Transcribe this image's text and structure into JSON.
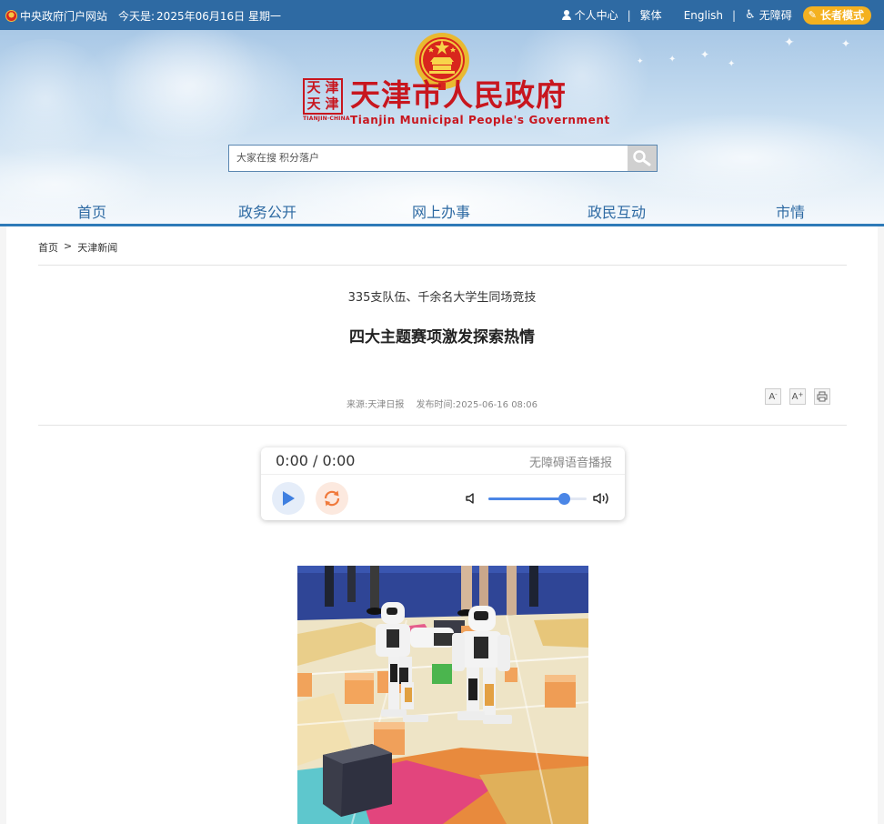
{
  "topbar": {
    "gov_portal": "中央政府门户网站",
    "date_prefix": "今天是:",
    "date": "2025年06月16日 星期一",
    "personal_center": "个人中心",
    "traditional": "繁体",
    "english": "English",
    "accessibility": "无障碍",
    "elder_mode": "长者模式",
    "separator": "|"
  },
  "header": {
    "seal_chars": [
      "天",
      "津",
      "天",
      "津"
    ],
    "seal_sub": "TIANJIN·CHINA",
    "title_cn": "天津市人民政府",
    "title_en": "Tianjin Municipal People's Government",
    "search_placeholder": "大家在搜 积分落户"
  },
  "nav": {
    "items": [
      {
        "label": "首页"
      },
      {
        "label": "政务公开"
      },
      {
        "label": "网上办事"
      },
      {
        "label": "政民互动"
      },
      {
        "label": "市情"
      }
    ]
  },
  "breadcrumb": {
    "home": "首页",
    "separator": ">",
    "current": "天津新闻"
  },
  "article": {
    "subtitle": "335支队伍、千余名大学生同场竞技",
    "title": "四大主题赛项激发探索热情",
    "source": "来源:天津日报",
    "published": "发布时间:2025-06-16 08:06"
  },
  "tools": {
    "font_decrease": "A",
    "font_decrease_sup": "-",
    "font_increase": "A",
    "font_increase_sup": "+"
  },
  "player": {
    "time": "0:00 / 0:00",
    "label": "无障碍语音播报",
    "volume": 0.77
  },
  "colors": {
    "topbar_bg": "#2e6aa3",
    "brand_red": "#c8161e",
    "nav_text": "#2e6aa3",
    "elder_btn": "#f4b120",
    "player_accent": "#4b86e6",
    "loop_accent": "#f07a3c"
  }
}
